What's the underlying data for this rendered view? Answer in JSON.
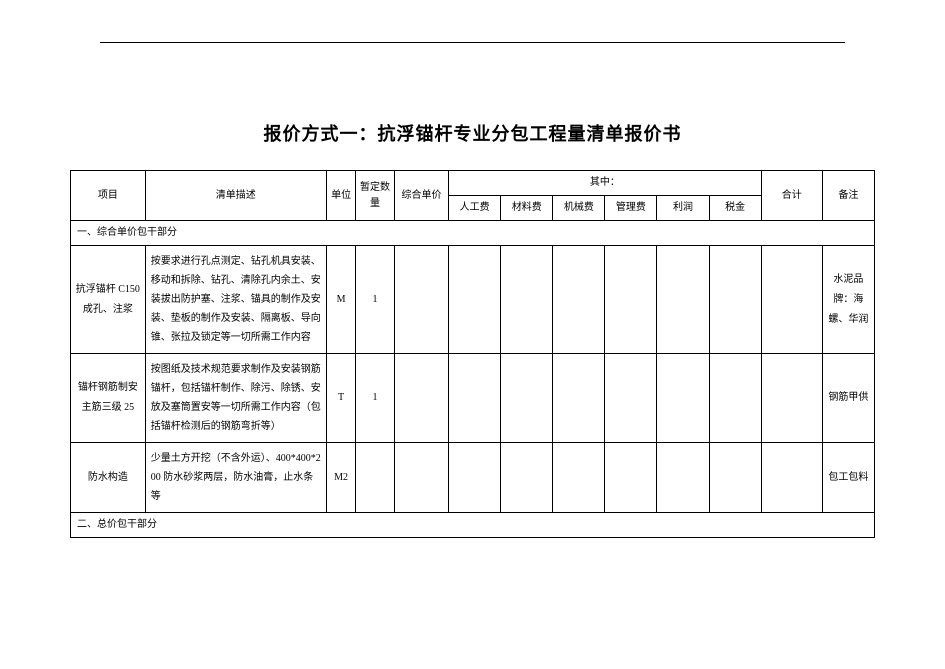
{
  "title": "报价方式一：抗浮锚杆专业分包工程量清单报价书",
  "headers": {
    "project": "项目",
    "desc": "清单描述",
    "unit": "单位",
    "qty": "暂定数量",
    "price": "综合单价",
    "breakdown": "其中：",
    "sub": {
      "labor": "人工费",
      "material": "材料费",
      "machine": "机械费",
      "manage": "管理费",
      "profit": "利润",
      "tax": "税金"
    },
    "total": "合计",
    "remark": "备注"
  },
  "section1": "一、综合单价包干部分",
  "section2": "二、总价包干部分",
  "rows": [
    {
      "project": "抗浮锚杆 C150 成孔、注浆",
      "desc": "按要求进行孔点测定、钻孔机具安装、移动和拆除、钻孔、清除孔内余土、安装拔出防护塞、注浆、锚具的制作及安装、垫板的制作及安装、隔离板、导向锥、张拉及锁定等一切所需工作内容",
      "unit": "M",
      "qty": "1",
      "remark": "水泥品牌：海螺、华润"
    },
    {
      "project": "锚杆钢筋制安主筋三级 25",
      "desc": "按图纸及技术规范要求制作及安装钢筋锚杆，包括锚杆制作、除污、除锈、安放及塞筒置安等一切所需工作内容（包括锚杆检测后的钢筋弯折等）",
      "unit": "T",
      "qty": "1",
      "remark": "钢筋甲供"
    },
    {
      "project": "防水构造",
      "desc": "少量土方开挖（不含外运）、400*400*200 防水砂浆两层，防水油膏，止水条等",
      "unit": "M2",
      "qty": "",
      "remark": "包工包料"
    }
  ],
  "chart_data": {
    "type": "table",
    "title": "报价方式一：抗浮锚杆专业分包工程量清单报价书",
    "columns": [
      "项目",
      "清单描述",
      "单位",
      "暂定数量",
      "综合单价",
      "人工费",
      "材料费",
      "机械费",
      "管理费",
      "利润",
      "税金",
      "合计",
      "备注"
    ],
    "sections": [
      {
        "name": "一、综合单价包干部分",
        "rows": [
          {
            "项目": "抗浮锚杆 C150 成孔、注浆",
            "清单描述": "按要求进行孔点测定、钻孔机具安装、移动和拆除、钻孔、清除孔内余土、安装拔出防护塞、注浆、锚具的制作及安装、垫板的制作及安装、隔离板、导向锥、张拉及锁定等一切所需工作内容",
            "单位": "M",
            "暂定数量": 1,
            "综合单价": null,
            "人工费": null,
            "材料费": null,
            "机械费": null,
            "管理费": null,
            "利润": null,
            "税金": null,
            "合计": null,
            "备注": "水泥品牌：海螺、华润"
          },
          {
            "项目": "锚杆钢筋制安主筋三级 25",
            "清单描述": "按图纸及技术规范要求制作及安装钢筋锚杆，包括锚杆制作、除污、除锈、安放及塞筒置安等一切所需工作内容（包括锚杆检测后的钢筋弯折等）",
            "单位": "T",
            "暂定数量": 1,
            "综合单价": null,
            "人工费": null,
            "材料费": null,
            "机械费": null,
            "管理费": null,
            "利润": null,
            "税金": null,
            "合计": null,
            "备注": "钢筋甲供"
          },
          {
            "项目": "防水构造",
            "清单描述": "少量土方开挖（不含外运）、400*400*200 防水砂浆两层，防水油膏，止水条等",
            "单位": "M2",
            "暂定数量": null,
            "综合单价": null,
            "人工费": null,
            "材料费": null,
            "机械费": null,
            "管理费": null,
            "利润": null,
            "税金": null,
            "合计": null,
            "备注": "包工包料"
          }
        ]
      },
      {
        "name": "二、总价包干部分",
        "rows": []
      }
    ]
  }
}
